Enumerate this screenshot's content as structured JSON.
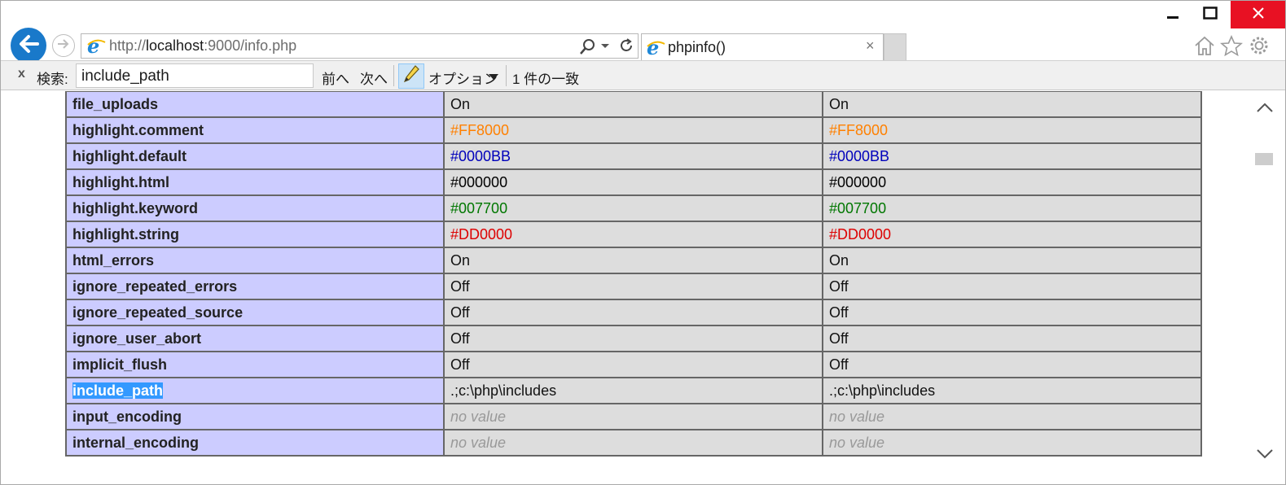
{
  "window": {
    "minimize_icon": "minimize-icon",
    "maximize_icon": "maximize-icon",
    "close_icon": "close-icon"
  },
  "address_bar": {
    "url_prefix": "http://",
    "url_host": "localhost",
    "url_rest": ":9000/info.php"
  },
  "tab": {
    "title": "phpinfo()",
    "close": "×"
  },
  "find_bar": {
    "close": "x",
    "label": "検索:",
    "query": "include_path",
    "prev_label": "前へ",
    "next_label": "次へ",
    "options_label": "オプション",
    "match_count": "1 件の一致"
  },
  "colors": {
    "directive_bg": "#ccccff",
    "value_bg": "#dddddd",
    "border": "#666666",
    "selection": "#3399ff",
    "close_red": "#e81123",
    "back_blue": "#1979ca"
  },
  "table": {
    "rows": [
      {
        "directive": "file_uploads",
        "local": "On",
        "master": "On"
      },
      {
        "directive": "highlight.comment",
        "local": "#FF8000",
        "master": "#FF8000",
        "color": "#FF8000"
      },
      {
        "directive": "highlight.default",
        "local": "#0000BB",
        "master": "#0000BB",
        "color": "#0000BB"
      },
      {
        "directive": "highlight.html",
        "local": "#000000",
        "master": "#000000",
        "color": "#000000"
      },
      {
        "directive": "highlight.keyword",
        "local": "#007700",
        "master": "#007700",
        "color": "#007700"
      },
      {
        "directive": "highlight.string",
        "local": "#DD0000",
        "master": "#DD0000",
        "color": "#DD0000"
      },
      {
        "directive": "html_errors",
        "local": "On",
        "master": "On"
      },
      {
        "directive": "ignore_repeated_errors",
        "local": "Off",
        "master": "Off"
      },
      {
        "directive": "ignore_repeated_source",
        "local": "Off",
        "master": "Off"
      },
      {
        "directive": "ignore_user_abort",
        "local": "Off",
        "master": "Off"
      },
      {
        "directive": "implicit_flush",
        "local": "Off",
        "master": "Off"
      },
      {
        "directive": "include_path",
        "local": ".;c:\\php\\includes",
        "master": ".;c:\\php\\includes",
        "highlighted": true
      },
      {
        "directive": "input_encoding",
        "local": "no value",
        "master": "no value",
        "novalue": true
      },
      {
        "directive": "internal_encoding",
        "local": "no value",
        "master": "no value",
        "novalue": true
      }
    ]
  }
}
